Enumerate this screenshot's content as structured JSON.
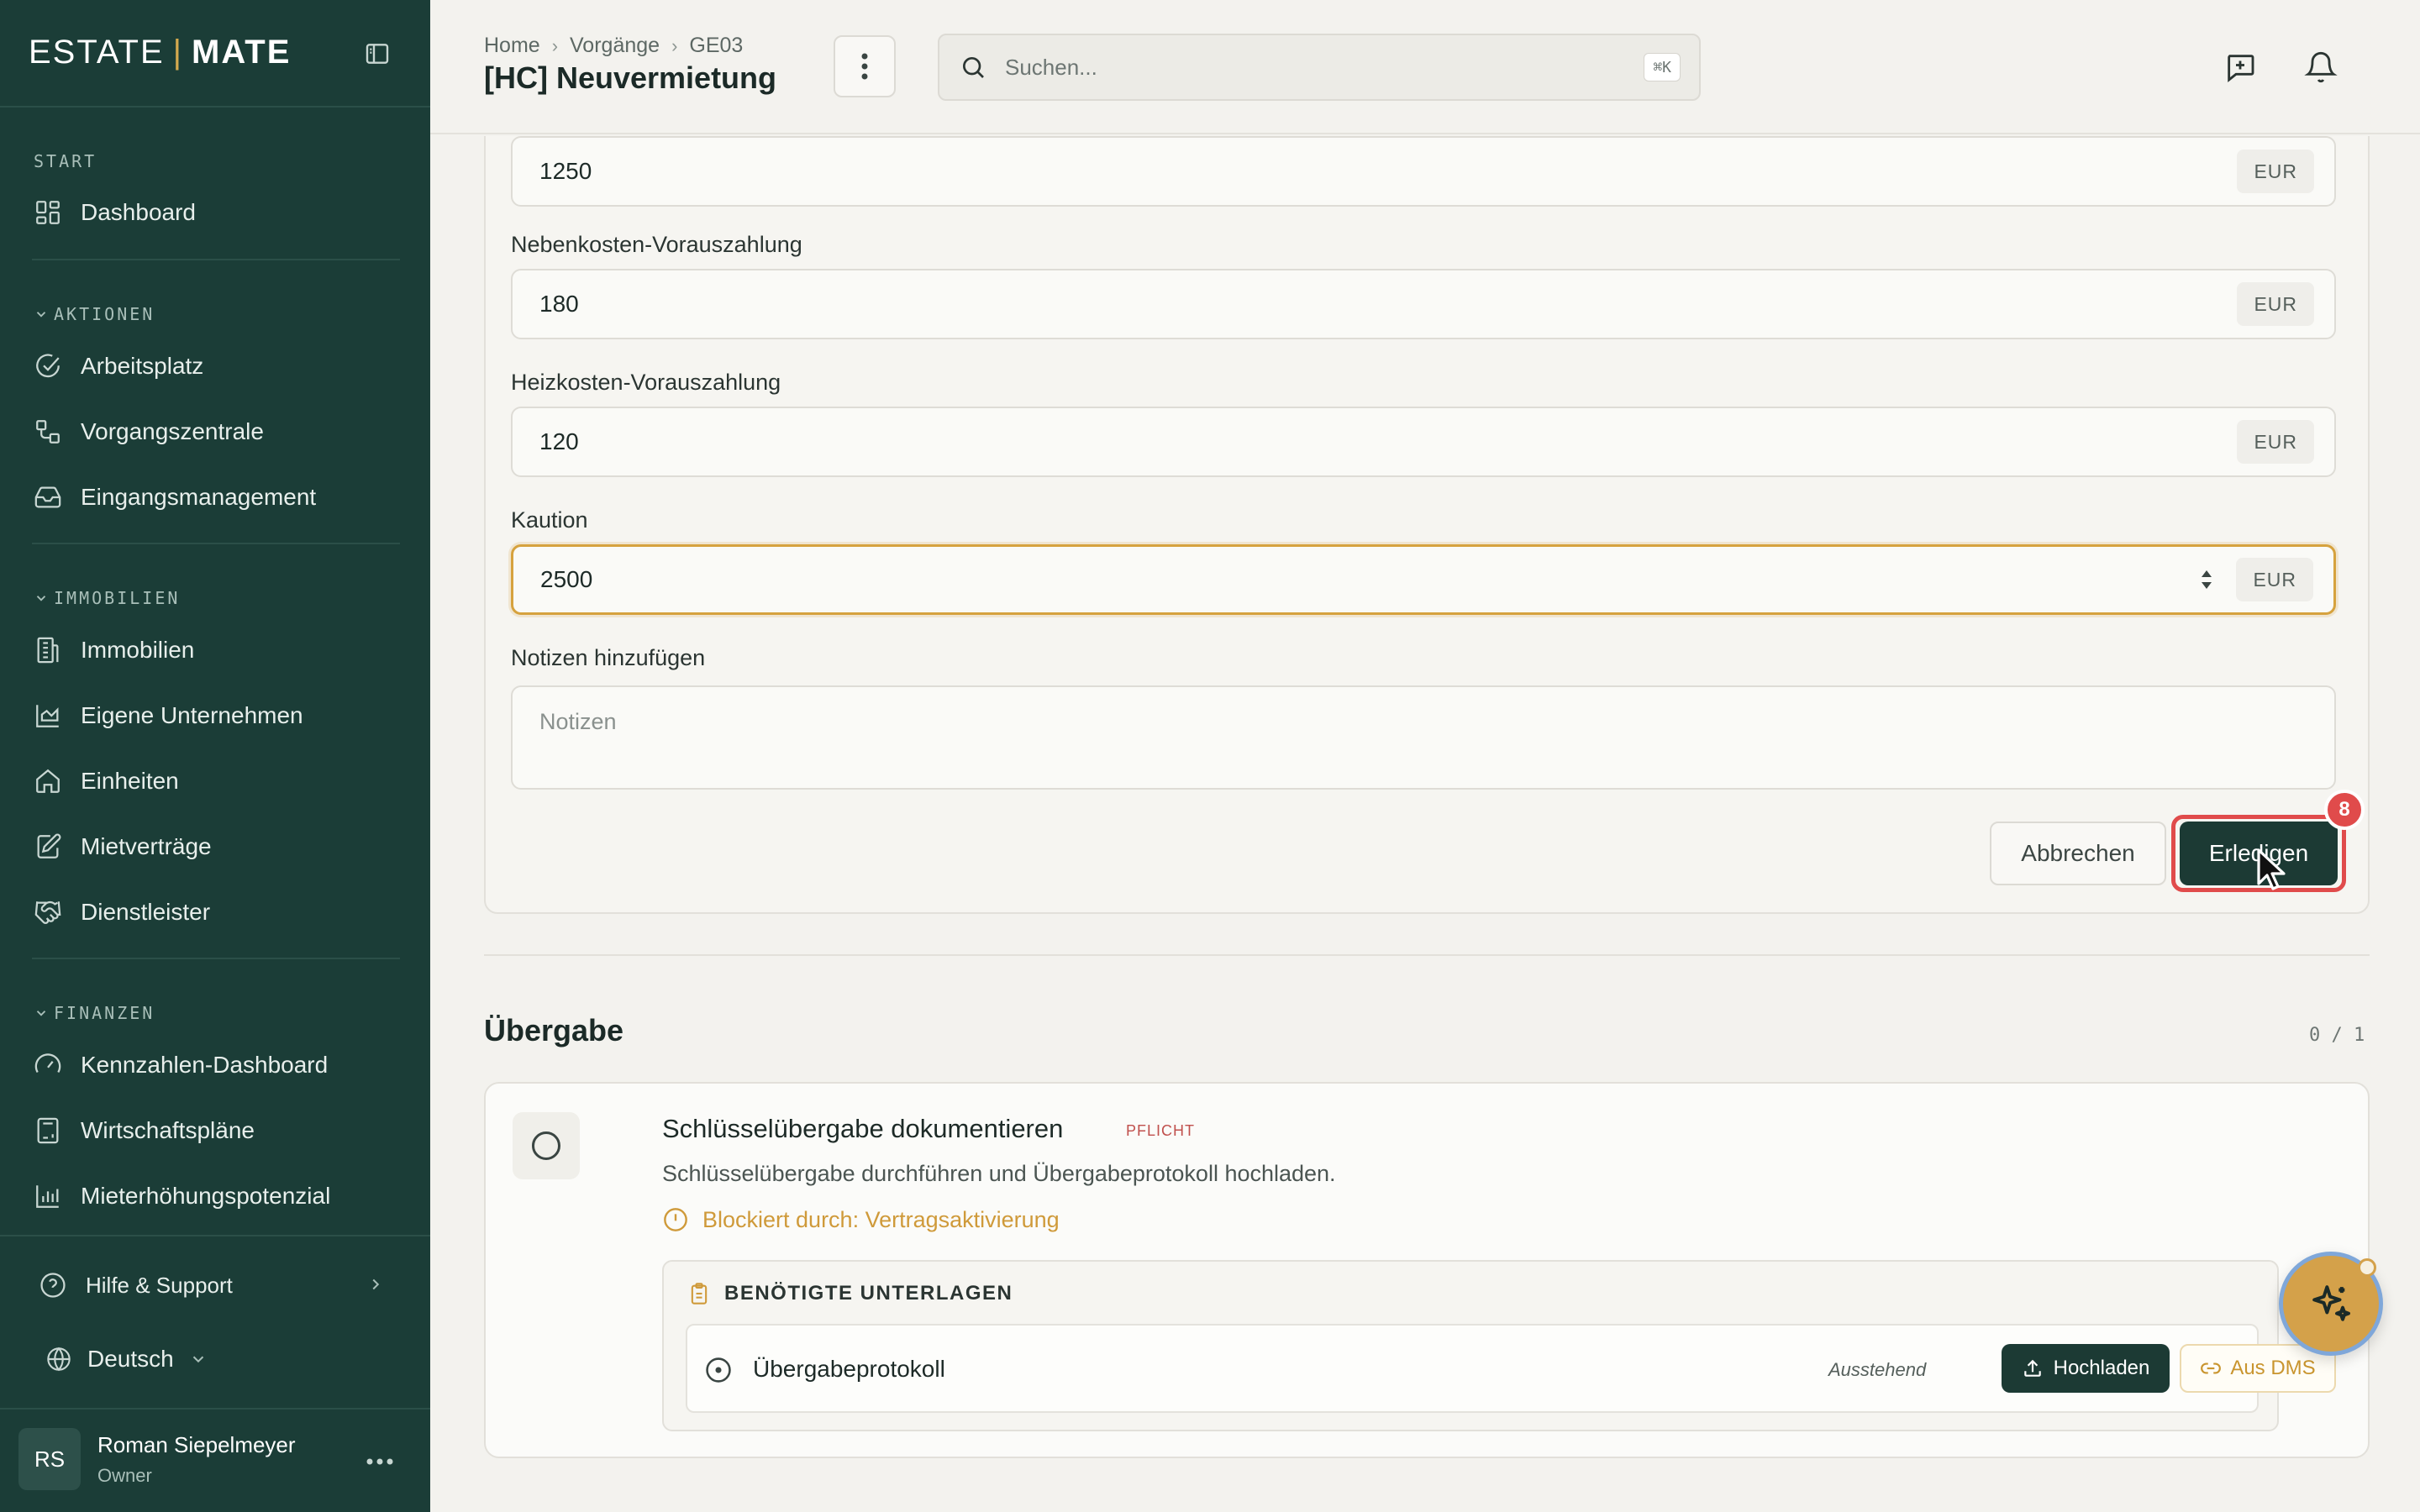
{
  "brand": {
    "left": "ESTATE",
    "sep": "|",
    "right": "MATE"
  },
  "sidebar": {
    "sections": [
      {
        "label": "START"
      },
      {
        "label": "AKTIONEN"
      },
      {
        "label": "IMMOBILIEN"
      },
      {
        "label": "FINANZEN"
      }
    ],
    "items": [
      {
        "label": "Dashboard",
        "icon": "dashboard-icon"
      },
      {
        "label": "Arbeitsplatz",
        "icon": "check-circle-icon"
      },
      {
        "label": "Vorgangszentrale",
        "icon": "workflow-icon"
      },
      {
        "label": "Eingangsmanagement",
        "icon": "inbox-icon"
      },
      {
        "label": "Immobilien",
        "icon": "building-icon"
      },
      {
        "label": "Eigene Unternehmen",
        "icon": "chart-area-icon"
      },
      {
        "label": "Einheiten",
        "icon": "home-icon"
      },
      {
        "label": "Mietverträge",
        "icon": "contract-icon"
      },
      {
        "label": "Dienstleister",
        "icon": "handshake-icon"
      },
      {
        "label": "Kennzahlen-Dashboard",
        "icon": "gauge-icon"
      },
      {
        "label": "Wirtschaftspläne",
        "icon": "calculator-icon"
      },
      {
        "label": "Mieterhöhungspotenzial",
        "icon": "bar-chart-icon"
      }
    ],
    "help": "Hilfe & Support",
    "language": "Deutsch",
    "user": {
      "initials": "RS",
      "name": "Roman Siepelmeyer",
      "role": "Owner"
    }
  },
  "header": {
    "breadcrumb": [
      "Home",
      "Vorgänge",
      "GE03"
    ],
    "title": "[HC] Neuvermietung",
    "search_placeholder": "Suchen...",
    "search_shortcut": "⌘K"
  },
  "form": {
    "fields": [
      {
        "label": "",
        "value": "1250",
        "unit": "EUR"
      },
      {
        "label": "Nebenkosten-Vorauszahlung",
        "value": "180",
        "unit": "EUR"
      },
      {
        "label": "Heizkosten-Vorauszahlung",
        "value": "120",
        "unit": "EUR"
      },
      {
        "label": "Kaution",
        "value": "2500",
        "unit": "EUR"
      }
    ],
    "notes_label": "Notizen hinzufügen",
    "notes_placeholder": "Notizen",
    "cancel_label": "Abbrechen",
    "done_label": "Erledigen",
    "badge": "8"
  },
  "handover": {
    "title": "Übergabe",
    "count": "0 / 1",
    "task": {
      "title": "Schlüsselübergabe dokumentieren",
      "tag": "PFLICHT",
      "description": "Schlüsselübergabe durchführen und Übergabeprotokoll hochladen.",
      "blocked": "Blockiert durch: Vertragsaktivierung",
      "docs_heading": "BENÖTIGTE UNTERLAGEN",
      "doc": {
        "name": "Übergabeprotokoll",
        "status": "Ausstehend",
        "upload_label": "Hochladen",
        "dms_label": "Aus DMS"
      }
    }
  },
  "colors": {
    "sidebar": "#1b3d37",
    "accent": "#d6a23e",
    "primary_button": "#1c3a34",
    "danger": "#e04b4b"
  }
}
